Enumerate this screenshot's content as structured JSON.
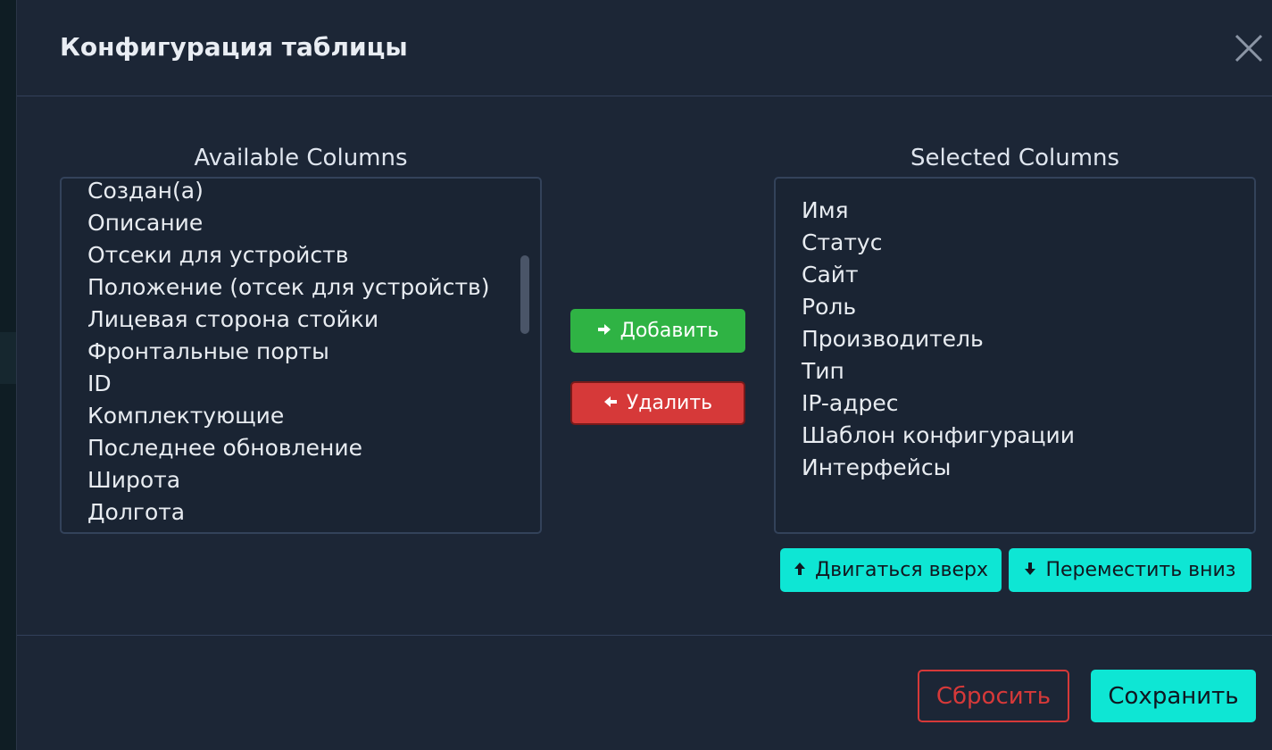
{
  "modal": {
    "title": "Конфигурация таблицы"
  },
  "available": {
    "label": "Available Columns",
    "items": [
      "Создан(а)",
      "Описание",
      "Отсеки для устройств",
      "Положение (отсек для устройств)",
      "Лицевая сторона стойки",
      "Фронтальные порты",
      "ID",
      "Комплектующие",
      "Последнее обновление",
      "Широта",
      "Долгота"
    ]
  },
  "selected": {
    "label": "Selected Columns",
    "items": [
      "Имя",
      "Статус",
      "Сайт",
      "Роль",
      "Производитель",
      "Тип",
      "IP-адрес",
      "Шаблон конфигурации",
      "Интерфейсы"
    ]
  },
  "actions": {
    "add_label": "Добавить",
    "remove_label": "Удалить",
    "move_up_label": "Двигаться вверх",
    "move_down_label": "Переместить вниз"
  },
  "footer": {
    "reset_label": "Сбросить",
    "save_label": "Сохранить"
  },
  "colors": {
    "success": "#2fb344",
    "danger": "#d63939",
    "accent": "#0ee6d4"
  }
}
